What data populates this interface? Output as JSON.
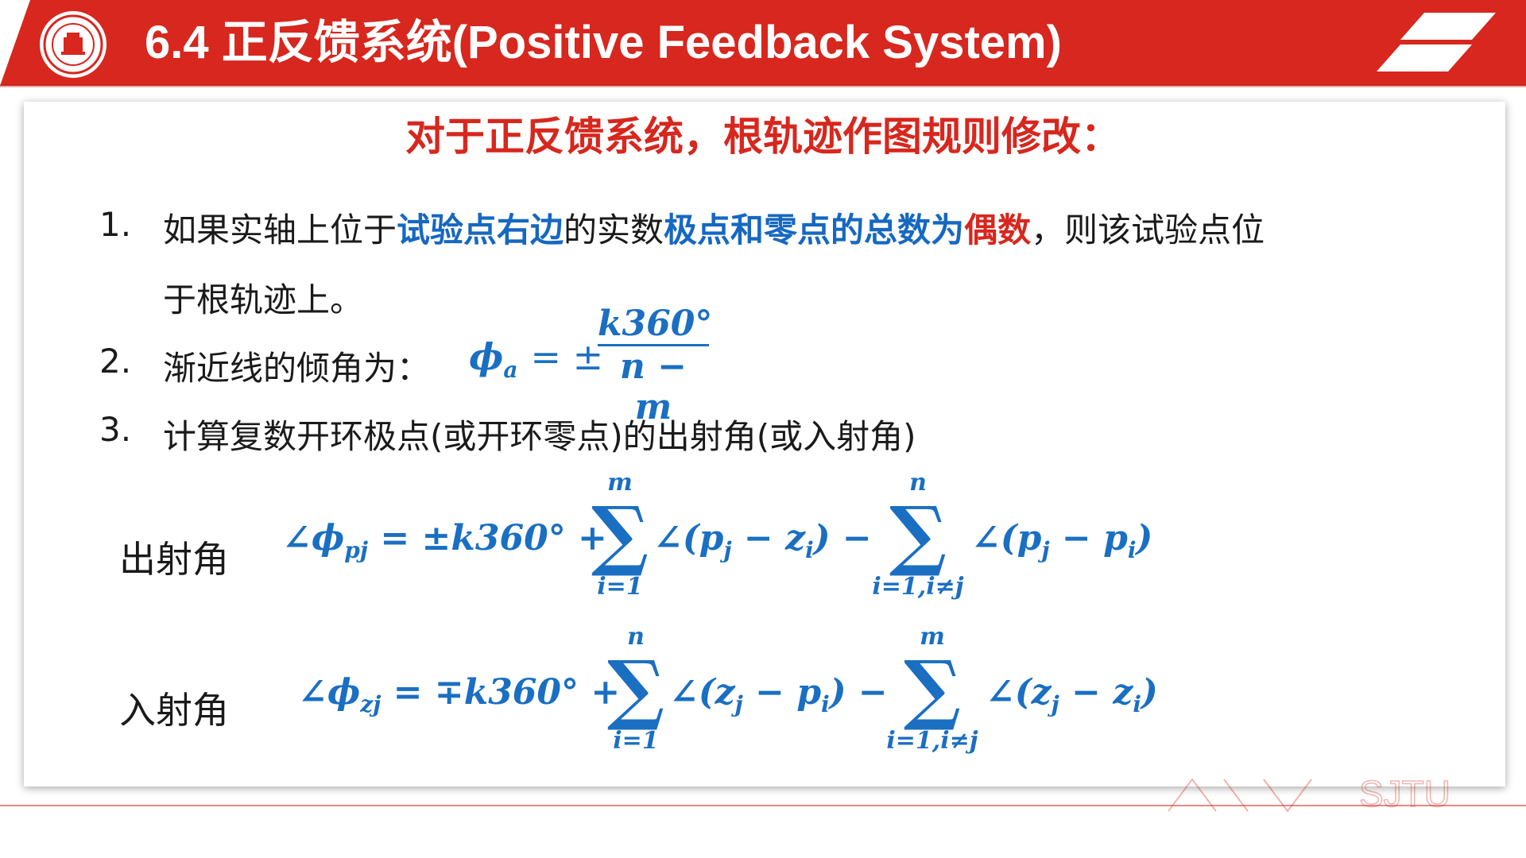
{
  "header": {
    "title": "6.4 正反馈系统(Positive Feedback System)",
    "accent": "#d7271e"
  },
  "logo": {
    "icon": "university-seal-icon"
  },
  "watermark": {
    "text": "SJTU"
  },
  "content": {
    "subtitle": "对于正反馈系统，根轨迹作图规则修改：",
    "items": [
      {
        "num": "1.",
        "t1": "如果实轴上位于",
        "b1": "试验点右边",
        "t2": "的实数",
        "b2": "极点和零点的总数为",
        "r1": "偶数",
        "t3": "，则该试验点位",
        "t4": "于根轨迹上。"
      },
      {
        "num": "2.",
        "text": "渐近线的倾角为：",
        "phi": "ϕ",
        "phi_sub": "a",
        "eq": "= ±",
        "numerator": "k360°",
        "denominator": "n − m"
      },
      {
        "num": "3.",
        "text": "计算复数开环极点(或开环零点)的出射角(或入射角)"
      }
    ],
    "departure": {
      "label": "出射角",
      "lhs": "∠ϕ",
      "lhs_sub": "pj",
      "rhs1": "= ±k360° +",
      "sum1_top": "m",
      "sum1_bottom": "i=1",
      "term1": "∠(p",
      "term1_sub1": "j",
      "term1_mid": " − z",
      "term1_sub2": "i",
      "term1_end": ") −",
      "sum2_top": "n",
      "sum2_bottom": "i=1,i≠j",
      "term2": "∠(p",
      "term2_sub1": "j",
      "term2_mid": " − p",
      "term2_sub2": "i",
      "term2_end": ")"
    },
    "arrival": {
      "label": "入射角",
      "lhs": "∠ϕ",
      "lhs_sub": "zj",
      "rhs1": "= ∓k360° +",
      "sum1_top": "n",
      "sum1_bottom": "i=1",
      "term1": "∠(z",
      "term1_sub1": "j",
      "term1_mid": " − p",
      "term1_sub2": "i",
      "term1_end": ") −",
      "sum2_top": "m",
      "sum2_bottom": "i=1,i≠j",
      "term2": "∠(z",
      "term2_sub1": "j",
      "term2_mid": " − z",
      "term2_sub2": "i",
      "term2_end": ")"
    },
    "sigma_symbol": "∑"
  }
}
